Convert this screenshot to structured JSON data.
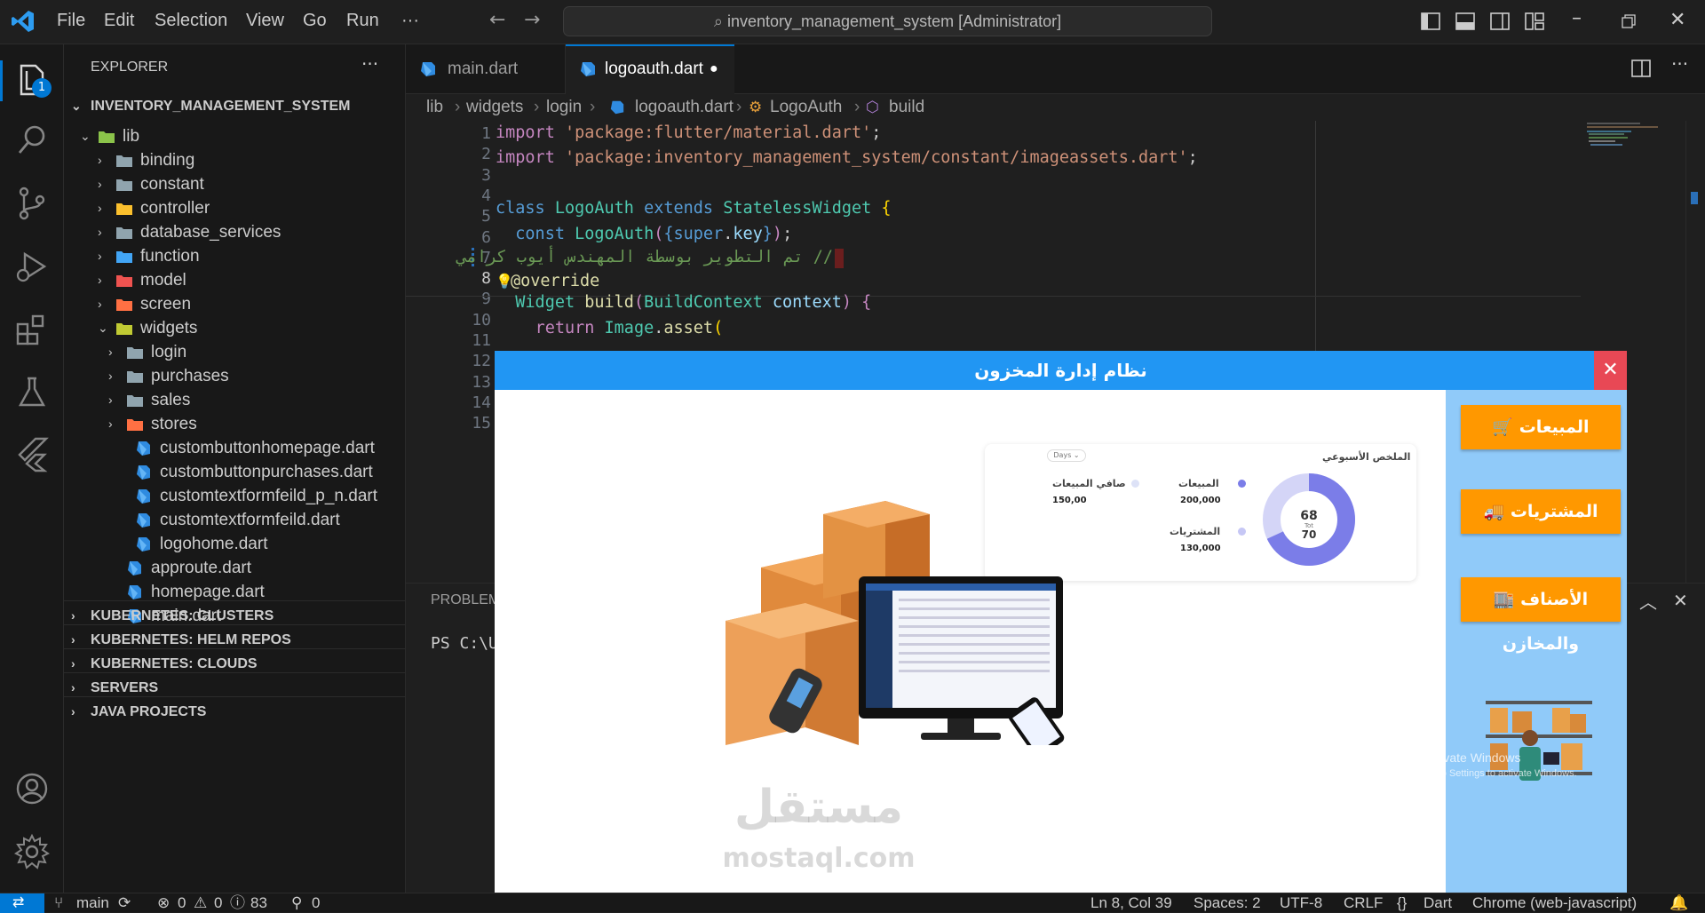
{
  "titlebar": {
    "menu": [
      "File",
      "Edit",
      "Selection",
      "View",
      "Go",
      "Run",
      "···"
    ],
    "search_text": "inventory_management_system [Administrator]"
  },
  "activity": {
    "explorer_badge": "1"
  },
  "explorer": {
    "title": "EXPLORER",
    "more": "···",
    "root": "INVENTORY_MANAGEMENT_SYSTEM",
    "items": [
      {
        "label": "lib",
        "level": 1,
        "kind": "folder-open",
        "icon": "lib-folder-icon"
      },
      {
        "label": "binding",
        "level": 2,
        "kind": "folder",
        "icon": "folder-icon"
      },
      {
        "label": "constant",
        "level": 2,
        "kind": "folder",
        "icon": "constant-folder-icon"
      },
      {
        "label": "controller",
        "level": 2,
        "kind": "folder",
        "icon": "controller-folder-icon"
      },
      {
        "label": "database_services",
        "level": 2,
        "kind": "folder",
        "icon": "folder-icon"
      },
      {
        "label": "function",
        "level": 2,
        "kind": "folder",
        "icon": "function-folder-icon"
      },
      {
        "label": "model",
        "level": 2,
        "kind": "folder",
        "icon": "model-folder-icon"
      },
      {
        "label": "screen",
        "level": 2,
        "kind": "folder",
        "icon": "screen-folder-icon"
      },
      {
        "label": "widgets",
        "level": 2,
        "kind": "folder-open",
        "icon": "widgets-folder-icon"
      },
      {
        "label": "login",
        "level": 3,
        "kind": "folder",
        "icon": "folder-icon"
      },
      {
        "label": "purchases",
        "level": 3,
        "kind": "folder",
        "icon": "folder-icon"
      },
      {
        "label": "sales",
        "level": 3,
        "kind": "folder",
        "icon": "folder-icon"
      },
      {
        "label": "stores",
        "level": 3,
        "kind": "folder",
        "icon": "stores-folder-icon"
      },
      {
        "label": "custombuttonhomepage.dart",
        "level": 4,
        "kind": "file",
        "icon": "dart-file-icon"
      },
      {
        "label": "custombuttonpurchases.dart",
        "level": 4,
        "kind": "file",
        "icon": "dart-file-icon"
      },
      {
        "label": "customtextformfeild_p_n.dart",
        "level": 4,
        "kind": "file",
        "icon": "dart-file-icon"
      },
      {
        "label": "customtextformfeild.dart",
        "level": 4,
        "kind": "file",
        "icon": "dart-file-icon"
      },
      {
        "label": "logohome.dart",
        "level": 4,
        "kind": "file",
        "icon": "dart-file-icon"
      },
      {
        "label": "approute.dart",
        "level": 3,
        "kind": "file",
        "icon": "dart-file-icon"
      },
      {
        "label": "homepage.dart",
        "level": 3,
        "kind": "file",
        "icon": "dart-file-icon"
      },
      {
        "label": "main.dart",
        "level": 3,
        "kind": "file",
        "icon": "dart-file-icon"
      }
    ],
    "sections": [
      "KUBERNETES: CLUSTERS",
      "KUBERNETES: HELM REPOS",
      "KUBERNETES: CLOUDS",
      "SERVERS",
      "JAVA PROJECTS"
    ]
  },
  "tabs": [
    {
      "label": "main.dart",
      "active": false
    },
    {
      "label": "logoauth.dart",
      "active": true
    }
  ],
  "breadcrumb": [
    "lib",
    "widgets",
    "login",
    "logoauth.dart",
    "LogoAuth",
    "build"
  ],
  "editor": {
    "line_numbers": [
      "1",
      "2",
      "3",
      "4",
      "5",
      "6",
      "7",
      "8",
      "9",
      "10",
      "11",
      "12",
      "13",
      "14",
      "15"
    ],
    "active_line": "8",
    "code": {
      "l1_kw": "import",
      "l1_str": "'package:flutter/material.dart'",
      "l1_end": ";",
      "l2_kw": "import",
      "l2_str": "'package:inventory_management_system/constant/imageassets.dart'",
      "l2_end": ";",
      "l4_kw1": "class",
      "l4_cls1": "LogoAuth",
      "l4_kw2": "extends",
      "l4_cls2": "StatelessWidget",
      "l4_brace": "{",
      "l5_kw": "const",
      "l5_cls": "LogoAuth",
      "l5_p1": "(",
      "l5_b1": "{",
      "l5_kw2": "super",
      "l5_dot": ".",
      "l5_var": "key",
      "l5_b2": "}",
      "l5_p2": ")",
      "l5_end": ";",
      "l6_comment": "// تم التطوير بوسطة المهندس أيوب كرامي",
      "l7_anno": "@override",
      "l8_cls1": "Widget",
      "l8_fn": "build",
      "l8_p1": "(",
      "l8_cls2": "BuildContext",
      "l8_var": "context",
      "l8_p2": ")",
      "l8_brace": "{",
      "l9_kw": "return",
      "l9_cls": "Image",
      "l9_dot": ".",
      "l9_fn": "asset",
      "l9_p": "("
    }
  },
  "panel": {
    "tab_label": "PROBLEM",
    "terminal_prompt": "PS C:\\U"
  },
  "statusbar": {
    "branch": "main",
    "errors": "0",
    "warnings": "0",
    "infos": "83",
    "ports": "0",
    "position": "Ln 8, Col 39",
    "spaces": "Spaces: 2",
    "encoding": "UTF-8",
    "eol": "CRLF",
    "braces": "{}",
    "language": "Dart",
    "debug_target": "Chrome (web-javascript)"
  },
  "app": {
    "title": "نظام إدارة المخزون",
    "close_glyph": "✕",
    "buttons": [
      "المبيعات",
      "المشتريات",
      "الأصناف والمخازن"
    ],
    "dashboard": {
      "heading": "الملخص الأسبوعي",
      "dropdown": "Days",
      "sales_label": "المبيعات",
      "sales_value": "200,000",
      "net_label": "صافي المبيعات",
      "net_value": "150,00",
      "purch_label": "المشتريات",
      "purch_value": "130,000",
      "donut_top": "68",
      "donut_mid": "Tot",
      "donut_bottom": "70",
      "donut_fraction": 0.68
    },
    "watermark_ar": "مستقل",
    "watermark_en": "mostaql.com",
    "activate_title": "Activate Windows",
    "activate_sub": "Go to Settings to activate Windows."
  }
}
